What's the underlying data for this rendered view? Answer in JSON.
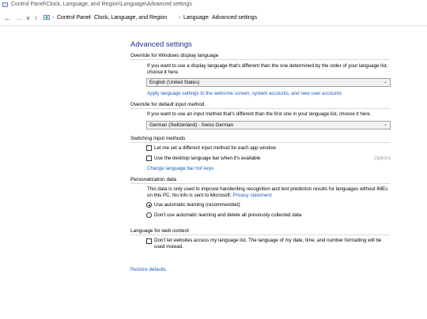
{
  "window": {
    "title": "Control Panel\\Clock, Language, and Region\\Language\\Advanced settings"
  },
  "nav": {
    "back_icon": "←",
    "forward_icon": "→",
    "recent_icon": "∨",
    "up_icon": "↑",
    "breadcrumb": [
      "Control Panel",
      "Clock, Language, and Region",
      "Language",
      "Advanced settings"
    ],
    "separator": "›"
  },
  "page": {
    "title": "Advanced settings"
  },
  "display_language": {
    "header": "Override for Windows display language",
    "description": "If you want to use a display language that's different than the one determined by the order of your language list, choose it here.",
    "selected": "English (United States)",
    "link": "Apply language settings to the welcome screen, system accounts, and new user accounts"
  },
  "input_method": {
    "header": "Override for default input method",
    "description": "If you want to use an input method that's different than the first one in your language list, choose it here.",
    "selected": "German (Switzerland) - Swiss German"
  },
  "switching": {
    "header": "Switching input methods",
    "option1": "Let me set a different input method for each app window",
    "option2": "Use the desktop language bar when it's available",
    "options_label": "Options",
    "link": "Change language bar hot keys"
  },
  "personalization": {
    "header": "Personalization data",
    "description": "This data is only used to improve handwriting recognition and text prediction results for languages without IMEs on this PC. No info is sent to Microsoft.",
    "privacy_link": "Privacy statement",
    "radio1": "Use automatic learning (recommended)",
    "radio2": "Don't use automatic learning and delete all previously collected data"
  },
  "web_content": {
    "header": "Language for web content",
    "option": "Don't let websites access my language list. The language of my date, time, and number formatting will be used instead."
  },
  "footer": {
    "restore_link": "Restore defaults"
  },
  "colors": {
    "title": "#1e3287",
    "link": "#1a5fb4"
  }
}
